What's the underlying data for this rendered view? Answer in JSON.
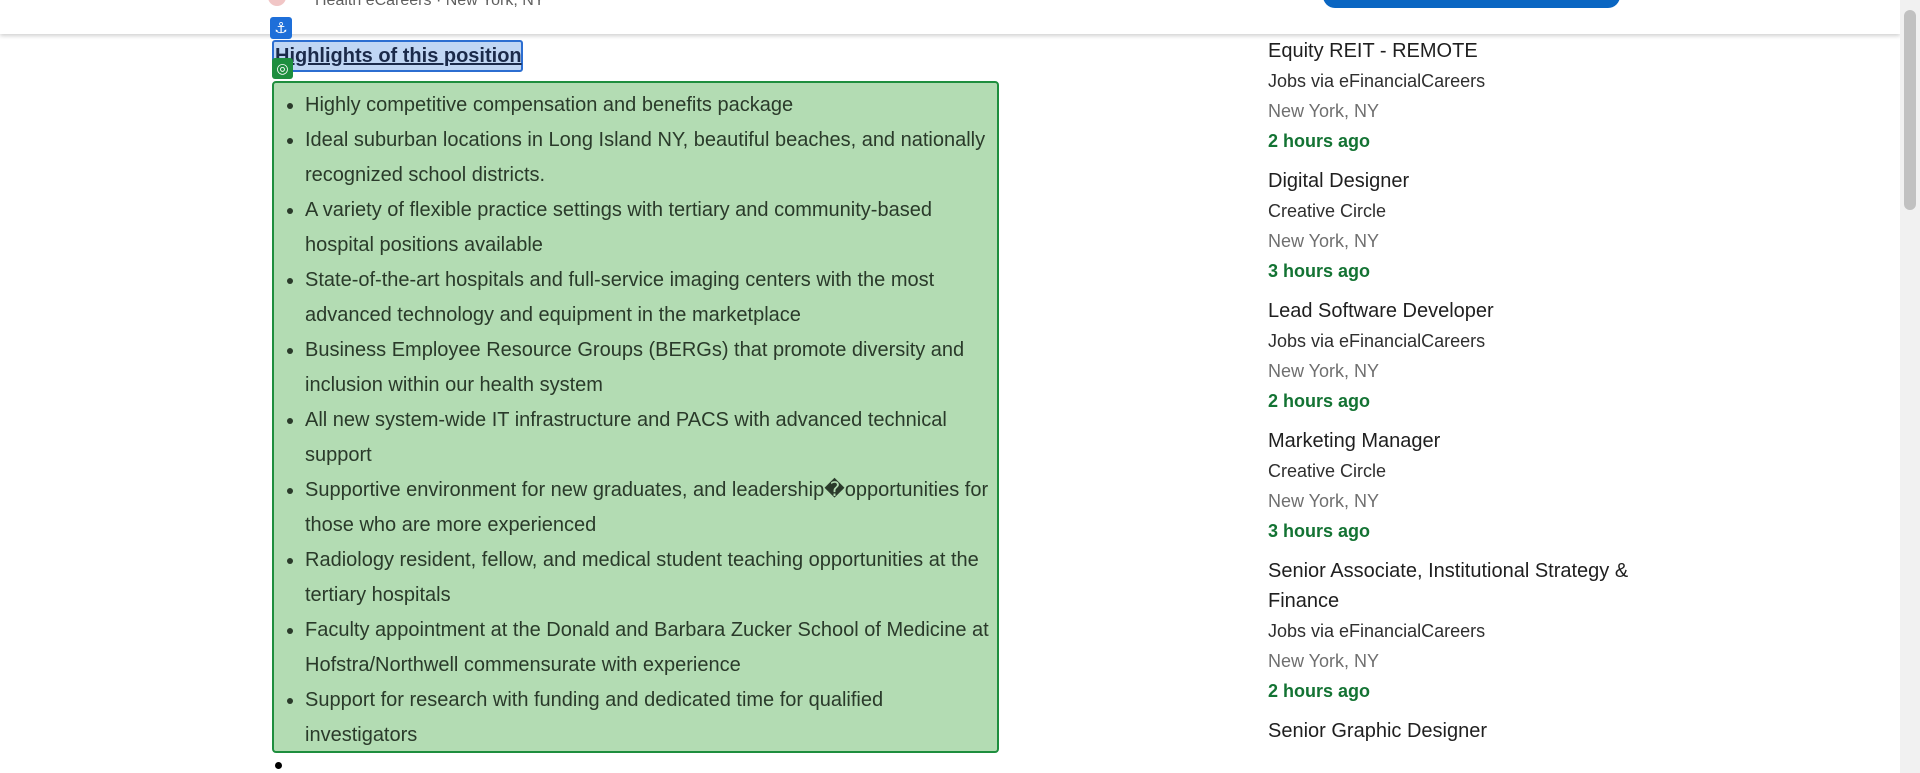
{
  "header": {
    "company_location": "Health eCareers · New York, NY"
  },
  "main": {
    "highlights_title": "Highlights of this position",
    "highlights": [
      "Highly competitive compensation and benefits package",
      "Ideal suburban locations in Long Island NY, beautiful beaches, and nationally recognized school districts.",
      "A variety of flexible practice settings with tertiary and community-based hospital positions available",
      "State-of-the-art hospitals and full-service imaging centers with the most advanced technology and equipment in the marketplace",
      "Business Employee Resource Groups (BERGs) that promote diversity and inclusion within our health system",
      "All new system-wide IT infrastructure and PACS with advanced technical support",
      "Supportive environment for new graduates, and leadership�opportunities for those who are more experienced",
      "Radiology resident, fellow, and medical student teaching opportunities at the tertiary hospitals",
      "Faculty appointment at the Donald and Barbara Zucker School of Medicine at Hofstra/Northwell commensurate with experience",
      "Support for research with funding and dedicated time for qualified investigators"
    ]
  },
  "related_jobs": [
    {
      "title": "Equity REIT - REMOTE",
      "company": "Jobs via eFinancialCareers",
      "location": "New York, NY",
      "posted": "2 hours ago"
    },
    {
      "title": "Digital Designer",
      "company": "Creative Circle",
      "location": "New York, NY",
      "posted": "3 hours ago"
    },
    {
      "title": "Lead Software Developer",
      "company": "Jobs via eFinancialCareers",
      "location": "New York, NY",
      "posted": "2 hours ago"
    },
    {
      "title": "Marketing Manager",
      "company": "Creative Circle",
      "location": "New York, NY",
      "posted": "3 hours ago"
    },
    {
      "title": "Senior Associate, Institutional Strategy & Finance",
      "company": "Jobs via eFinancialCareers",
      "location": "New York, NY",
      "posted": "2 hours ago"
    },
    {
      "title": "Senior Graphic Designer",
      "company": "",
      "location": "",
      "posted": ""
    }
  ],
  "icons": {
    "anchor": "anchor-icon",
    "target": "target-icon"
  },
  "colors": {
    "accent_blue": "#0a66c2",
    "posted_green": "#137333",
    "highlight_box_green": "#b3dcb3"
  }
}
